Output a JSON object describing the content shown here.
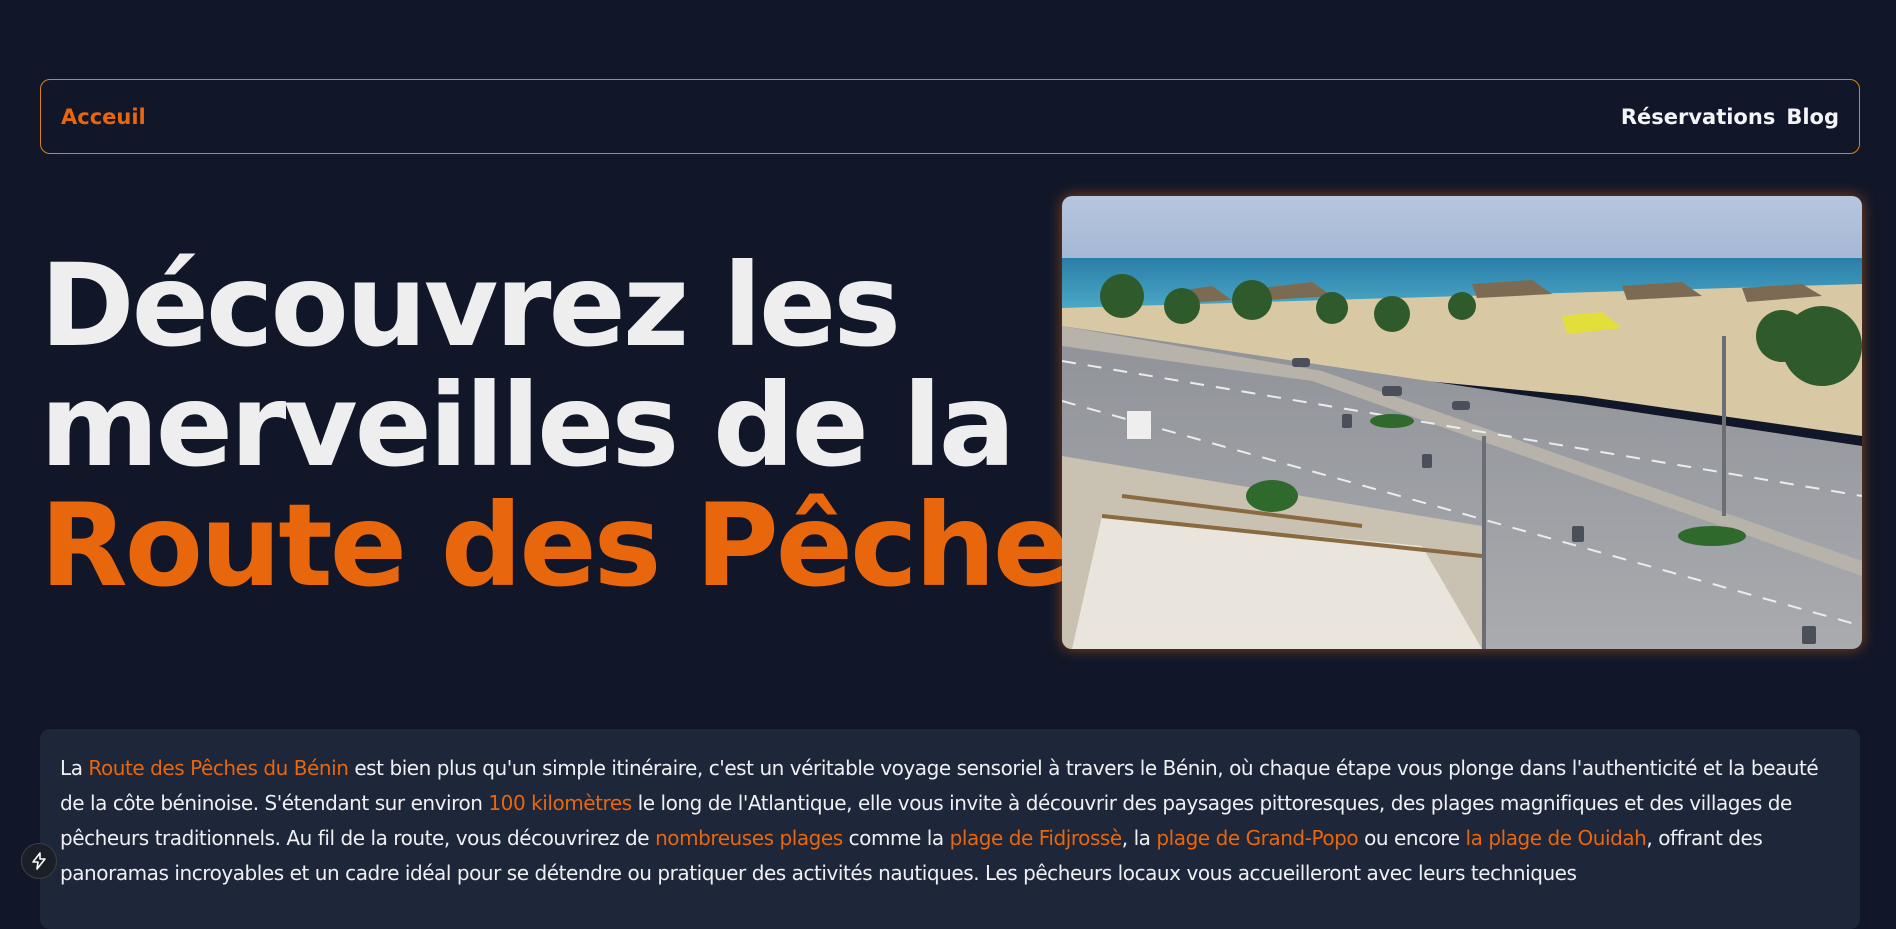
{
  "nav": {
    "home_label": "Acceuil",
    "reservations_label": "Réservations",
    "blog_label": "Blog"
  },
  "hero": {
    "title_line1": "Découvrez les",
    "title_line2": "merveilles de la",
    "title_accent": "Route des Pêches",
    "image": {
      "description_icon": "beach-road-photo"
    }
  },
  "intro": {
    "t1": "La ",
    "h1": "Route des Pêches du Bénin",
    "t2": " est bien plus qu'un simple itinéraire, c'est un véritable voyage sensoriel à travers le Bénin, où chaque étape vous plonge dans l'authenticité et la beauté de la côte béninoise. S'étendant sur environ ",
    "h2": "100 kilomètres",
    "t3": " le long de l'Atlantique, elle vous invite à découvrir des paysages pittoresques, des plages magnifiques et des villages de pêcheurs traditionnels. Au fil de la route, vous découvrirez de ",
    "h3": "nombreuses plages",
    "t4": " comme la ",
    "h4": "plage de Fidjrossè",
    "t5": ", la ",
    "h5": "plage de Grand-Popo",
    "t6": " ou encore ",
    "h6": "la plage de Ouidah",
    "t7": ", offrant des panoramas incroyables et un cadre idéal pour se détendre ou pratiquer des activités nautiques. Les pêcheurs locaux vous accueilleront avec leurs techniques"
  },
  "badge": {
    "icon": "lightning-icon"
  },
  "colors": {
    "background": "#111729",
    "accent": "#e8660c",
    "card": "#1e2639"
  }
}
